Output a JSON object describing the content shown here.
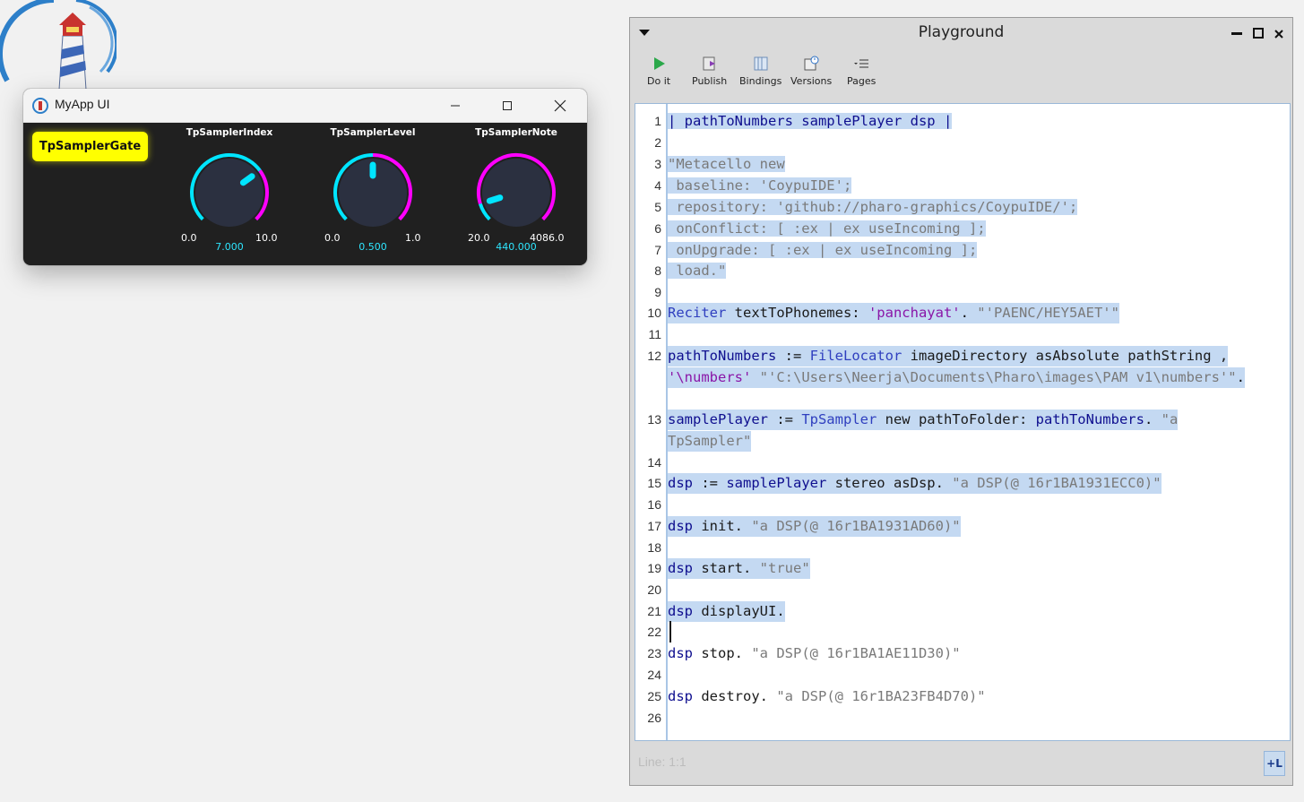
{
  "desktop": {
    "logo_icon": "pharo-lighthouse-icon"
  },
  "app_window": {
    "title": "MyApp UI",
    "gate_button": "TpSamplerGate",
    "knobs": [
      {
        "label": "TpSamplerIndex",
        "min": "0.0",
        "max": "10.0",
        "value": "7.000",
        "fraction": 0.7
      },
      {
        "label": "TpSamplerLevel",
        "min": "0.0",
        "max": "1.0",
        "value": "0.500",
        "fraction": 0.5
      },
      {
        "label": "TpSamplerNote",
        "min": "20.0",
        "max": "4086.0",
        "value": "440.000",
        "fraction": 0.103
      }
    ],
    "colors": {
      "knob_active": "#00e5ff",
      "knob_rest": "#ff00ff",
      "gate": "#ffff00"
    }
  },
  "playground": {
    "title": "Playground",
    "toolbar": [
      {
        "label": "Do it",
        "icon": "play-icon"
      },
      {
        "label": "Publish",
        "icon": "publish-icon"
      },
      {
        "label": "Bindings",
        "icon": "bindings-icon"
      },
      {
        "label": "Versions",
        "icon": "versions-icon"
      },
      {
        "label": "Pages",
        "icon": "pages-icon"
      }
    ],
    "line_numbers": [
      "1",
      "2",
      "3",
      "4",
      "5",
      "6",
      "7",
      "8",
      "9",
      "10",
      "11",
      "12",
      "13",
      "14",
      "15",
      "16",
      "17",
      "18",
      "19",
      "20",
      "21",
      "22",
      "23",
      "24",
      "25",
      "26"
    ],
    "code": {
      "l1": "| pathToNumbers samplePlayer dsp |",
      "l3": "\"Metacello new",
      "l4": " baseline: 'CoypuIDE';",
      "l5": " repository: 'github://pharo-graphics/CoypuIDE/';",
      "l6": " onConflict: [ :ex | ex useIncoming ];",
      "l7": " onUpgrade: [ :ex | ex useIncoming ];",
      "l8": " load.\"",
      "l10a": "Reciter",
      "l10b": " textToPhonemes: ",
      "l10c": "'panchayat'",
      "l10d": ". ",
      "l10e": "\"'PAENC/HEY5AET'\"",
      "l12a": "pathToNumbers",
      "l12b": " := ",
      "l12c": "FileLocator",
      "l12d": " imageDirectory asAbsolute pathString ,",
      "l12e": "'\\numbers'",
      "l12f": " ",
      "l12g": "\"'C:\\Users\\Neerja\\Documents\\Pharo\\images\\PAM v1\\numbers'\"",
      "l12h": ".",
      "l13a": "samplePlayer",
      "l13b": " := ",
      "l13c": "TpSampler",
      "l13d": " new pathToFolder: ",
      "l13e": "pathToNumbers",
      "l13f": ". ",
      "l13g": "\"a",
      "l13h": "TpSampler\"",
      "l15a": "dsp",
      "l15b": " := ",
      "l15c": "samplePlayer",
      "l15d": " stereo asDsp. ",
      "l15e": "\"a DSP(@ 16r1BA1931ECC0)\"",
      "l17a": "dsp",
      "l17b": " init. ",
      "l17c": "\"a DSP(@ 16r1BA1931AD60)\"",
      "l19a": "dsp",
      "l19b": " start. ",
      "l19c": "\"true\"",
      "l21a": "dsp",
      "l21b": " displayUI.",
      "l23a": "dsp",
      "l23b": " stop. ",
      "l23c": "\"a DSP(@ 16r1BA1AE11D30)\"",
      "l25a": "dsp",
      "l25b": " destroy. ",
      "l25c": "\"a DSP(@ 16r1BA23FB4D70)\""
    },
    "status": "Line: 1:1",
    "plus_l": "+L"
  }
}
